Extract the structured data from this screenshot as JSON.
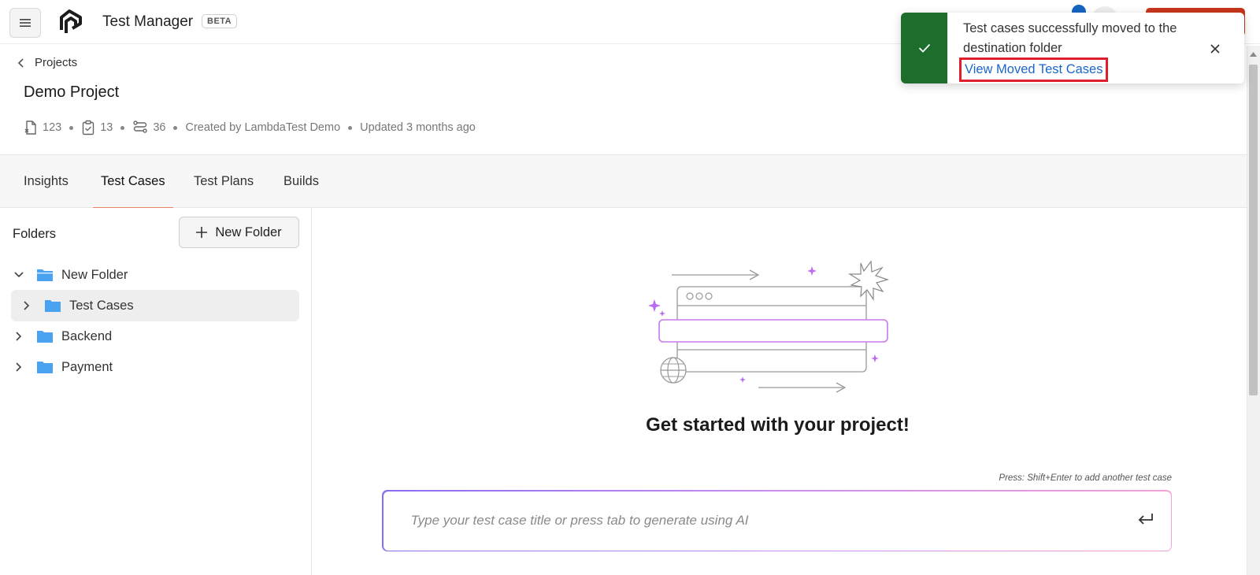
{
  "header": {
    "app_title": "Test Manager",
    "badge": "BETA",
    "menu_icon": "hamburger-icon",
    "logo_icon": "lambdatest-logo"
  },
  "breadcrumb": {
    "label": "Projects",
    "icon": "chevron-left-icon"
  },
  "project": {
    "title": "Demo Project",
    "stats": [
      {
        "icon": "test-case-icon",
        "value": "123"
      },
      {
        "icon": "clipboard-check-icon",
        "value": "13"
      },
      {
        "icon": "workflow-icon",
        "value": "36"
      }
    ],
    "created_by": "Created by LambdaTest Demo",
    "updated": "Updated 3 months ago"
  },
  "tabs": [
    {
      "label": "Insights",
      "active": false
    },
    {
      "label": "Test Cases",
      "active": true
    },
    {
      "label": "Test Plans",
      "active": false
    },
    {
      "label": "Builds",
      "active": false
    }
  ],
  "sidebar": {
    "heading": "Folders",
    "new_folder_label": "New Folder",
    "folders": [
      {
        "label": "New Folder",
        "expanded": true,
        "depth": 0,
        "selected": false
      },
      {
        "label": "Test Cases",
        "expanded": false,
        "depth": 1,
        "selected": true
      },
      {
        "label": "Backend",
        "expanded": false,
        "depth": 0,
        "selected": false
      },
      {
        "label": "Payment",
        "expanded": false,
        "depth": 0,
        "selected": false
      }
    ],
    "folder_color": "#4aa3f0"
  },
  "main": {
    "headline": "Get started with your project!",
    "hint": "Press: Shift+Enter to add another test case",
    "input_placeholder": "Type your test case title or press tab to generate using AI",
    "input_value": ""
  },
  "toast": {
    "message": "Test cases successfully moved to the destination folder",
    "link_label": "View Moved Test Cases",
    "status_color": "#1d6e2d",
    "link_color": "#1a66c7"
  },
  "colors": {
    "active_tab_underline": "#e98466",
    "highlight_border": "#e01e2c",
    "accent_purple": "#b86cf0"
  }
}
